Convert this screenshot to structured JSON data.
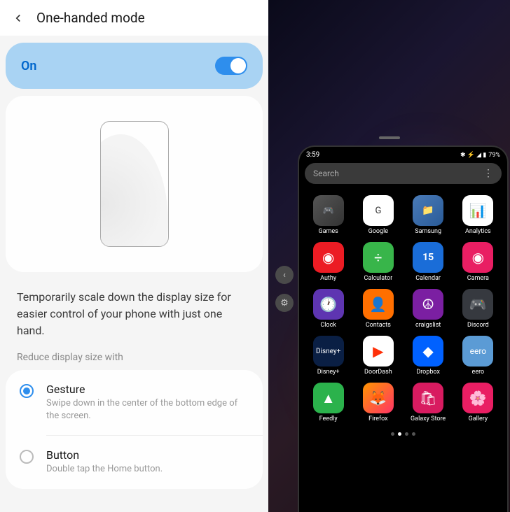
{
  "header": {
    "title": "One-handed mode"
  },
  "toggle": {
    "label": "On",
    "state": true
  },
  "description": "Temporarily scale down the display size for easier control of your phone with just one hand.",
  "section_label": "Reduce display size with",
  "options": [
    {
      "title": "Gesture",
      "subtitle": "Swipe down in the center of the bottom edge of the screen.",
      "selected": true
    },
    {
      "title": "Button",
      "subtitle": "Double tap the Home button.",
      "selected": false
    }
  ],
  "preview": {
    "status": {
      "time": "3:59",
      "battery": "79%",
      "icons": "✱ ⚡ ◢ ▮"
    },
    "search_placeholder": "Search",
    "apps": [
      {
        "label": "Games",
        "icon_class": "ic-games",
        "glyph": "🎮"
      },
      {
        "label": "Google",
        "icon_class": "ic-google",
        "glyph": "G"
      },
      {
        "label": "Samsung",
        "icon_class": "ic-samsung",
        "glyph": "📁"
      },
      {
        "label": "Analytics",
        "icon_class": "ic-analytics",
        "glyph": "📊"
      },
      {
        "label": "Authy",
        "icon_class": "ic-authy",
        "glyph": "◉"
      },
      {
        "label": "Calculator",
        "icon_class": "ic-calculator",
        "glyph": "÷"
      },
      {
        "label": "Calendar",
        "icon_class": "ic-calendar",
        "glyph": "15"
      },
      {
        "label": "Camera",
        "icon_class": "ic-camera",
        "glyph": "◉"
      },
      {
        "label": "Clock",
        "icon_class": "ic-clock",
        "glyph": "🕐"
      },
      {
        "label": "Contacts",
        "icon_class": "ic-contacts",
        "glyph": "👤"
      },
      {
        "label": "craigslist",
        "icon_class": "ic-craigslist",
        "glyph": "☮"
      },
      {
        "label": "Discord",
        "icon_class": "ic-discord",
        "glyph": "🎮"
      },
      {
        "label": "Disney+",
        "icon_class": "ic-disney",
        "glyph": "Disney+"
      },
      {
        "label": "DoorDash",
        "icon_class": "ic-doordash",
        "glyph": "▶"
      },
      {
        "label": "Dropbox",
        "icon_class": "ic-dropbox",
        "glyph": "◆"
      },
      {
        "label": "eero",
        "icon_class": "ic-eero",
        "glyph": "eero"
      },
      {
        "label": "Feedly",
        "icon_class": "ic-feedly",
        "glyph": "▲"
      },
      {
        "label": "Firefox",
        "icon_class": "ic-firefox",
        "glyph": "🦊"
      },
      {
        "label": "Galaxy Store",
        "icon_class": "ic-galaxystore",
        "glyph": "🛍"
      },
      {
        "label": "Gallery",
        "icon_class": "ic-gallery",
        "glyph": "🌸"
      }
    ],
    "page_indicator": {
      "total": 4,
      "active": 1
    }
  }
}
